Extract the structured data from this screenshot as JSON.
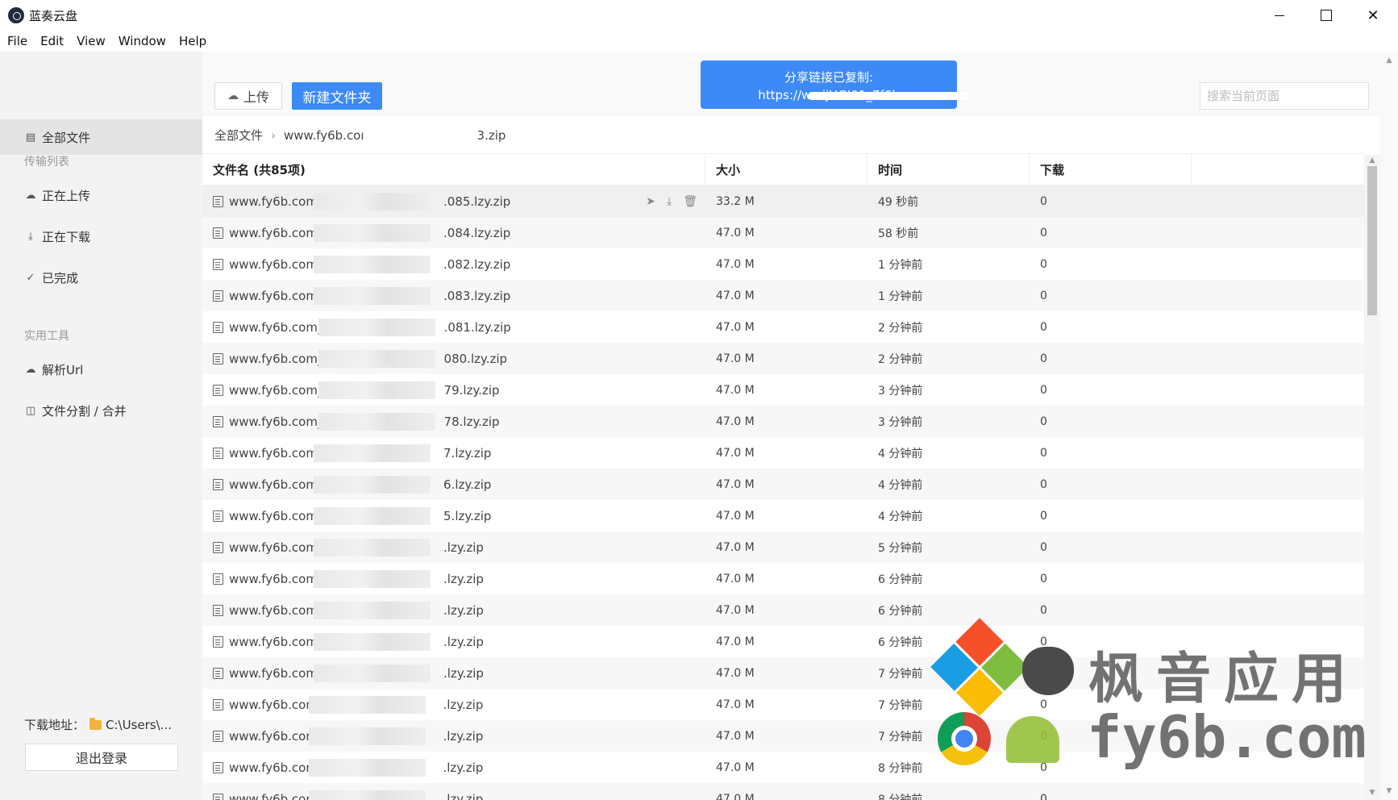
{
  "window": {
    "title": "蓝奏云盘",
    "controls": {
      "minimize": "",
      "maximize": "",
      "close": "✕"
    }
  },
  "menu": [
    "File",
    "Edit",
    "View",
    "Window",
    "Help"
  ],
  "sidebar": {
    "items": [
      {
        "label": "全部文件",
        "icon": "file-icon",
        "active": true
      },
      {
        "label": "正在上传",
        "icon": "cloud-upload-icon"
      },
      {
        "label": "正在下载",
        "icon": "download-icon"
      },
      {
        "label": "已完成",
        "icon": "check-circle-icon"
      },
      {
        "label": "解析Url",
        "icon": "cloud-icon"
      },
      {
        "label": "文件分割 / 合并",
        "icon": "split-icon"
      }
    ],
    "sections": {
      "transfer": "传输列表",
      "tools": "实用工具"
    },
    "download_label": "下载地址：",
    "download_path": "C:\\Users\\...",
    "logout": "退出登录"
  },
  "toolbar": {
    "upload": "上传",
    "new_folder": "新建文件夹",
    "search_placeholder": "搜索当前页面"
  },
  "toast": {
    "line1": "分享链接已复制:",
    "line2": "https://wv                  ijUGI01_7f6b"
  },
  "breadcrumb": {
    "root": "全部文件",
    "file_prefix": "www.fy6b.coı",
    "file_suffix": "3.zip"
  },
  "table": {
    "headers": {
      "name": "文件名 (共85项)",
      "size": "大小",
      "time": "时间",
      "downloads": "下载"
    },
    "rows": [
      {
        "name_prefix": "www.fy6b.com_2",
        "name_suffix": ".085.lzy.zip",
        "size": "33.2 M",
        "time": "49 秒前",
        "downloads": "0"
      },
      {
        "name_prefix": "www.fy6b.com_2",
        "name_suffix": ".084.lzy.zip",
        "size": "47.0 M",
        "time": "58 秒前",
        "downloads": "0"
      },
      {
        "name_prefix": "www.fy6b.com_2",
        "name_suffix": ".082.lzy.zip",
        "size": "47.0 M",
        "time": "1 分钟前",
        "downloads": "0"
      },
      {
        "name_prefix": "www.fy6b.com_2",
        "name_suffix": ".083.lzy.zip",
        "size": "47.0 M",
        "time": "1 分钟前",
        "downloads": "0"
      },
      {
        "name_prefix": "www.fy6b.com_20",
        "name_suffix": ".081.lzy.zip",
        "size": "47.0 M",
        "time": "2 分钟前",
        "downloads": "0"
      },
      {
        "name_prefix": "www.fy6b.com_20",
        "name_suffix": "080.lzy.zip",
        "size": "47.0 M",
        "time": "2 分钟前",
        "downloads": "0"
      },
      {
        "name_prefix": "www.fy6b.com_20",
        "name_suffix": "79.lzy.zip",
        "size": "47.0 M",
        "time": "3 分钟前",
        "downloads": "0"
      },
      {
        "name_prefix": "www.fy6b.com_20",
        "name_suffix": "78.lzy.zip",
        "size": "47.0 M",
        "time": "3 分钟前",
        "downloads": "0"
      },
      {
        "name_prefix": "www.fy6b.com_2",
        "name_suffix": "7.lzy.zip",
        "size": "47.0 M",
        "time": "4 分钟前",
        "downloads": "0"
      },
      {
        "name_prefix": "www.fy6b.com_2",
        "name_suffix": "6.lzy.zip",
        "size": "47.0 M",
        "time": "4 分钟前",
        "downloads": "0"
      },
      {
        "name_prefix": "www.fy6b.com_2",
        "name_suffix": "5.lzy.zip",
        "size": "47.0 M",
        "time": "4 分钟前",
        "downloads": "0"
      },
      {
        "name_prefix": "www.fy6b.com_2",
        "name_suffix": ".lzy.zip",
        "size": "47.0 M",
        "time": "5 分钟前",
        "downloads": "0"
      },
      {
        "name_prefix": "www.fy6b.com_2",
        "name_suffix": ".lzy.zip",
        "size": "47.0 M",
        "time": "6 分钟前",
        "downloads": "0"
      },
      {
        "name_prefix": "www.fy6b.com_2",
        "name_suffix": ".lzy.zip",
        "size": "47.0 M",
        "time": "6 分钟前",
        "downloads": "0"
      },
      {
        "name_prefix": "www.fy6b.com_2",
        "name_suffix": ".lzy.zip",
        "size": "47.0 M",
        "time": "6 分钟前",
        "downloads": "0"
      },
      {
        "name_prefix": "www.fy6b.com_2",
        "name_suffix": ".lzy.zip",
        "size": "47.0 M",
        "time": "7 分钟前",
        "downloads": "0"
      },
      {
        "name_prefix": "www.fy6b.com_",
        "name_suffix": ".lzy.zip",
        "size": "47.0 M",
        "time": "7 分钟前",
        "downloads": "0"
      },
      {
        "name_prefix": "www.fy6b.com_",
        "name_suffix": ".lzy.zip",
        "size": "47.0 M",
        "time": "7 分钟前",
        "downloads": "0"
      },
      {
        "name_prefix": "www.fy6b.com_",
        "name_suffix": ".lzy.zip",
        "size": "47.0 M",
        "time": "8 分钟前",
        "downloads": "0"
      },
      {
        "name_prefix": "www.fy6b.com_",
        "name_suffix": ".lzy.zip",
        "size": "47.0 M",
        "time": "8 分钟前",
        "downloads": "0"
      }
    ]
  },
  "watermark": {
    "line1": "枫音应用",
    "line2": "fy6b.com"
  },
  "colors": {
    "accent": "#3d8af7",
    "sidebar_bg": "#f3f3f3",
    "active_bg": "#e4e4e4"
  }
}
